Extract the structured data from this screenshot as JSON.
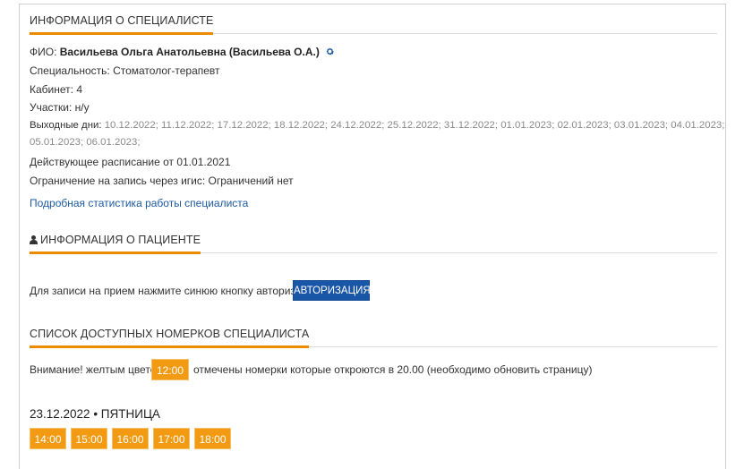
{
  "specialist": {
    "section_title": "ИНФОРМАЦИЯ О СПЕЦИАЛИСТЕ",
    "fio_label": "ФИО: ",
    "fio_value": "Васильева Ольга Анатольевна (Васильева О.А.)",
    "specialty_label": "Специальность: ",
    "specialty_value": "Стоматолог-терапевт",
    "cabinet_label": "Кабинет: ",
    "cabinet_value": "4",
    "areas_label": "Участки: ",
    "areas_value": "н/у",
    "days_off_label": "Выходные дни: ",
    "days_off_line1": "10.12.2022; 11.12.2022; 17.12.2022; 18.12.2022; 24.12.2022; 25.12.2022; 31.12.2022; 01.01.2023; 02.01.2023; 03.01.2023; 04.01.2023;",
    "days_off_line2": "05.01.2023; 06.01.2023;",
    "schedule_text": "Действующее расписание от 01.01.2021",
    "restriction_text": "Ограничение на запись через игис: Ограничений нет",
    "stats_link": "Подробная статистика работы специалиста"
  },
  "patient": {
    "section_title": "ИНФОРМАЦИЯ О ПАЦИЕНТЕ",
    "auth_hint": "Для записи на прием нажмите синюю кнопку авторизация",
    "auth_button": "АВТОРИЗАЦИЯ"
  },
  "slots": {
    "section_title": "СПИСОК ДОСТУПНЫХ НОМЕРКОВ СПЕЦИАЛИСТА",
    "notice_before": "Внимание! желтым цветом",
    "notice_sample": "12:00",
    "notice_after": "отмечены номерки которые откроются в 20.00 (необходимо обновить страницу)",
    "day_title": "23.12.2022 • ПЯТНИЦА",
    "times": [
      "14:00",
      "15:00",
      "16:00",
      "17:00",
      "18:00"
    ]
  },
  "colors": {
    "accent": "#ec8a00",
    "slot": "#f29a11",
    "button": "#1a56a8",
    "link": "#1d5aa0"
  },
  "icons": {
    "settings": "gear-icon",
    "patient": "person-icon"
  }
}
